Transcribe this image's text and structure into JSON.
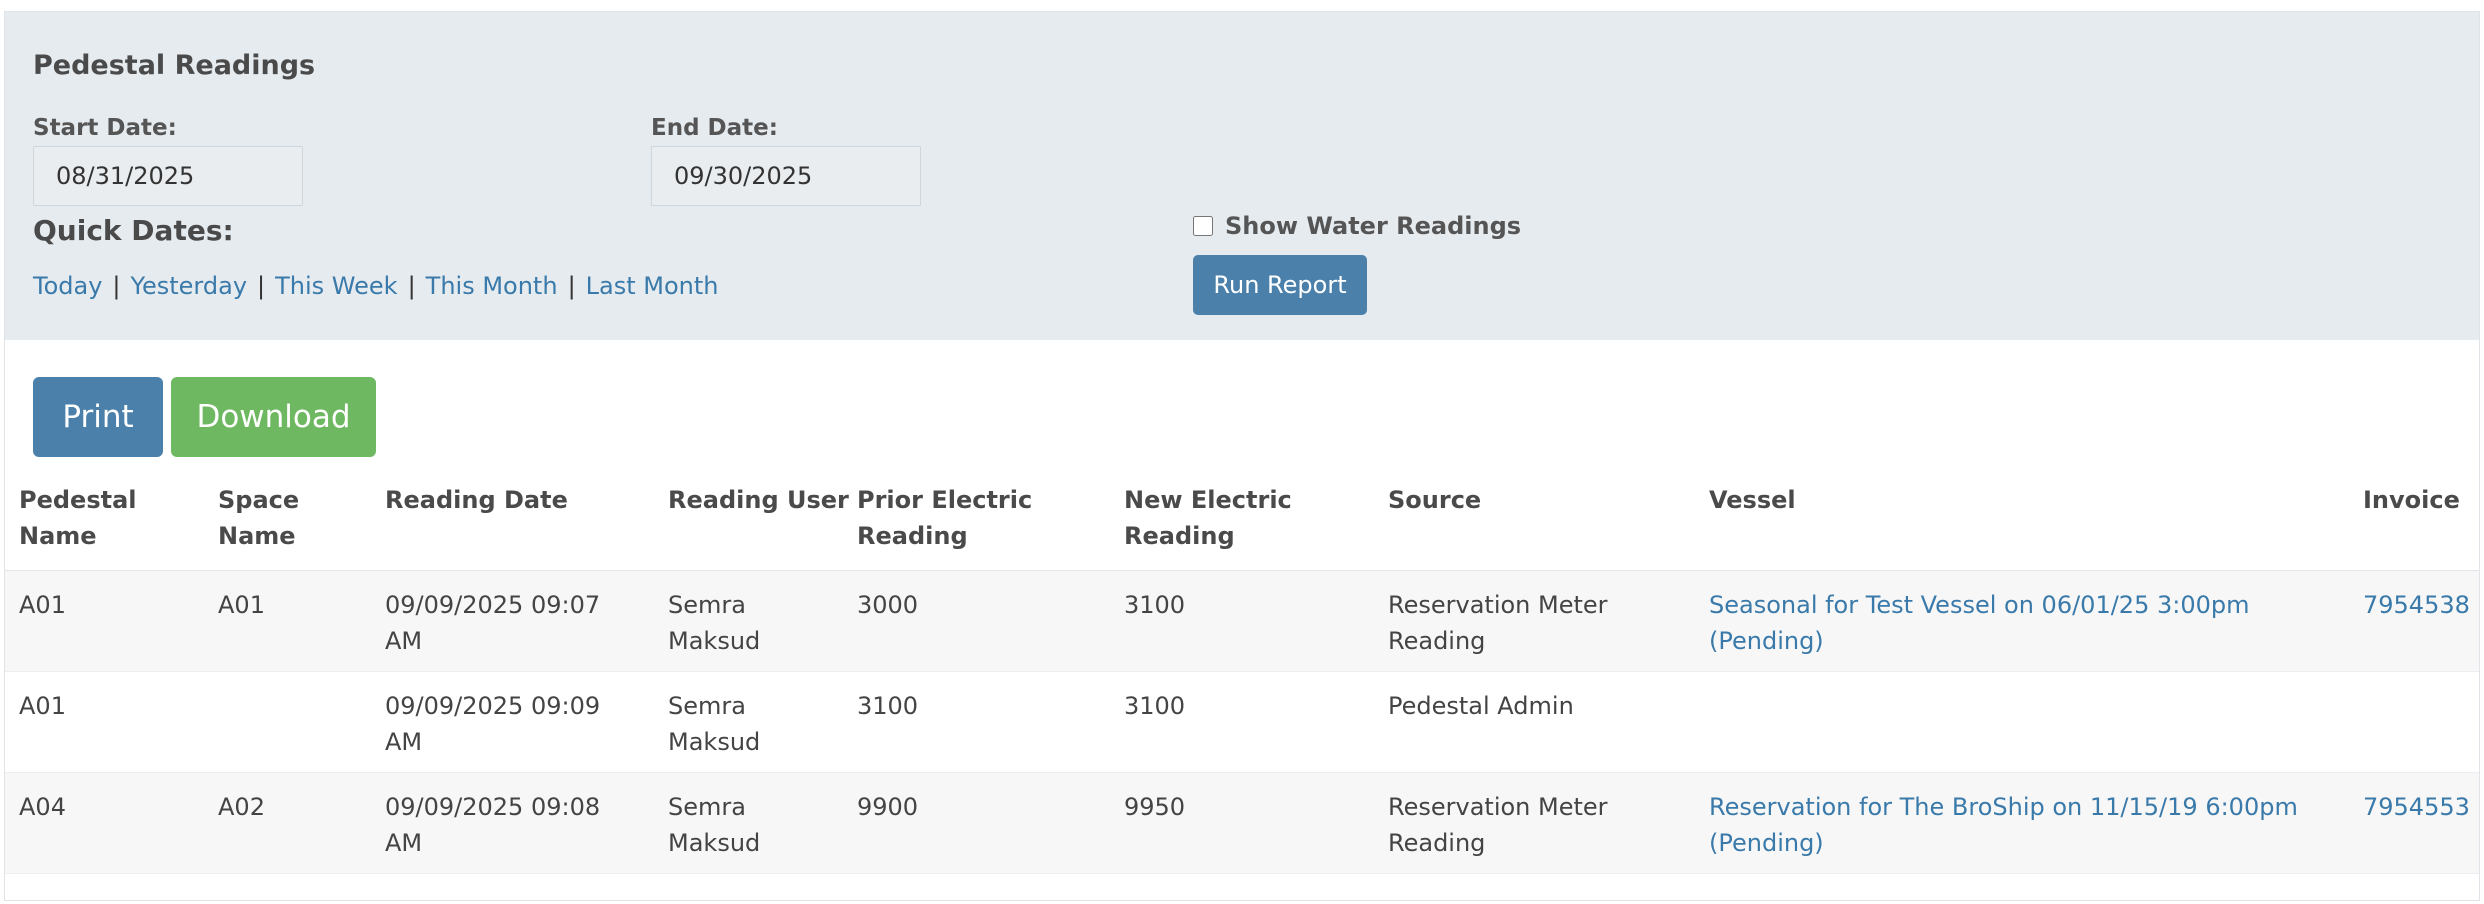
{
  "filters": {
    "title": "Pedestal Readings",
    "start_date_label": "Start Date:",
    "start_date_value": "08/31/2025",
    "end_date_label": "End Date:",
    "end_date_value": "09/30/2025",
    "quick_dates_label": "Quick Dates:",
    "quick_dates": [
      "Today",
      "Yesterday",
      "This Week",
      "This Month",
      "Last Month"
    ],
    "separator": "|",
    "show_water_label": "Show Water Readings",
    "show_water_checked": false,
    "run_report_label": "Run Report"
  },
  "actions": {
    "print_label": "Print",
    "download_label": "Download"
  },
  "table": {
    "headers": [
      [
        "Pedestal",
        "Name"
      ],
      [
        "Space",
        "Name"
      ],
      [
        "Reading Date"
      ],
      [
        "Reading User"
      ],
      [
        "Prior Electric",
        "Reading"
      ],
      [
        "New Electric",
        "Reading"
      ],
      [
        "Source"
      ],
      [
        "Vessel"
      ],
      [
        "Invoice"
      ]
    ],
    "rows": [
      {
        "pedestal": "A01",
        "space": "A01",
        "date": [
          "09/09/2025 09:07",
          "AM"
        ],
        "user": [
          "Semra",
          "Maksud"
        ],
        "prior": "3000",
        "new": "3100",
        "source": [
          "Reservation Meter",
          "Reading"
        ],
        "vessel": [
          "Seasonal for Test Vessel on 06/01/25 3:00pm",
          "(Pending)"
        ],
        "invoice": "7954538"
      },
      {
        "pedestal": "A01",
        "space": "",
        "date": [
          "09/09/2025 09:09",
          "AM"
        ],
        "user": [
          "Semra",
          "Maksud"
        ],
        "prior": "3100",
        "new": "3100",
        "source": [
          "Pedestal Admin",
          ""
        ],
        "vessel": [
          "",
          ""
        ],
        "invoice": ""
      },
      {
        "pedestal": "A04",
        "space": "A02",
        "date": [
          "09/09/2025 09:08",
          "AM"
        ],
        "user": [
          "Semra",
          "Maksud"
        ],
        "prior": "9900",
        "new": "9950",
        "source": [
          "Reservation Meter",
          "Reading"
        ],
        "vessel": [
          "Reservation for The BroShip on 11/15/19 6:00pm",
          "(Pending)"
        ],
        "invoice": "7954553"
      }
    ]
  },
  "colors": {
    "panel_bg": "#e6ebef",
    "link": "#3a7aaa",
    "primary_button": "#4a80aa",
    "success_button": "#6eb861"
  }
}
